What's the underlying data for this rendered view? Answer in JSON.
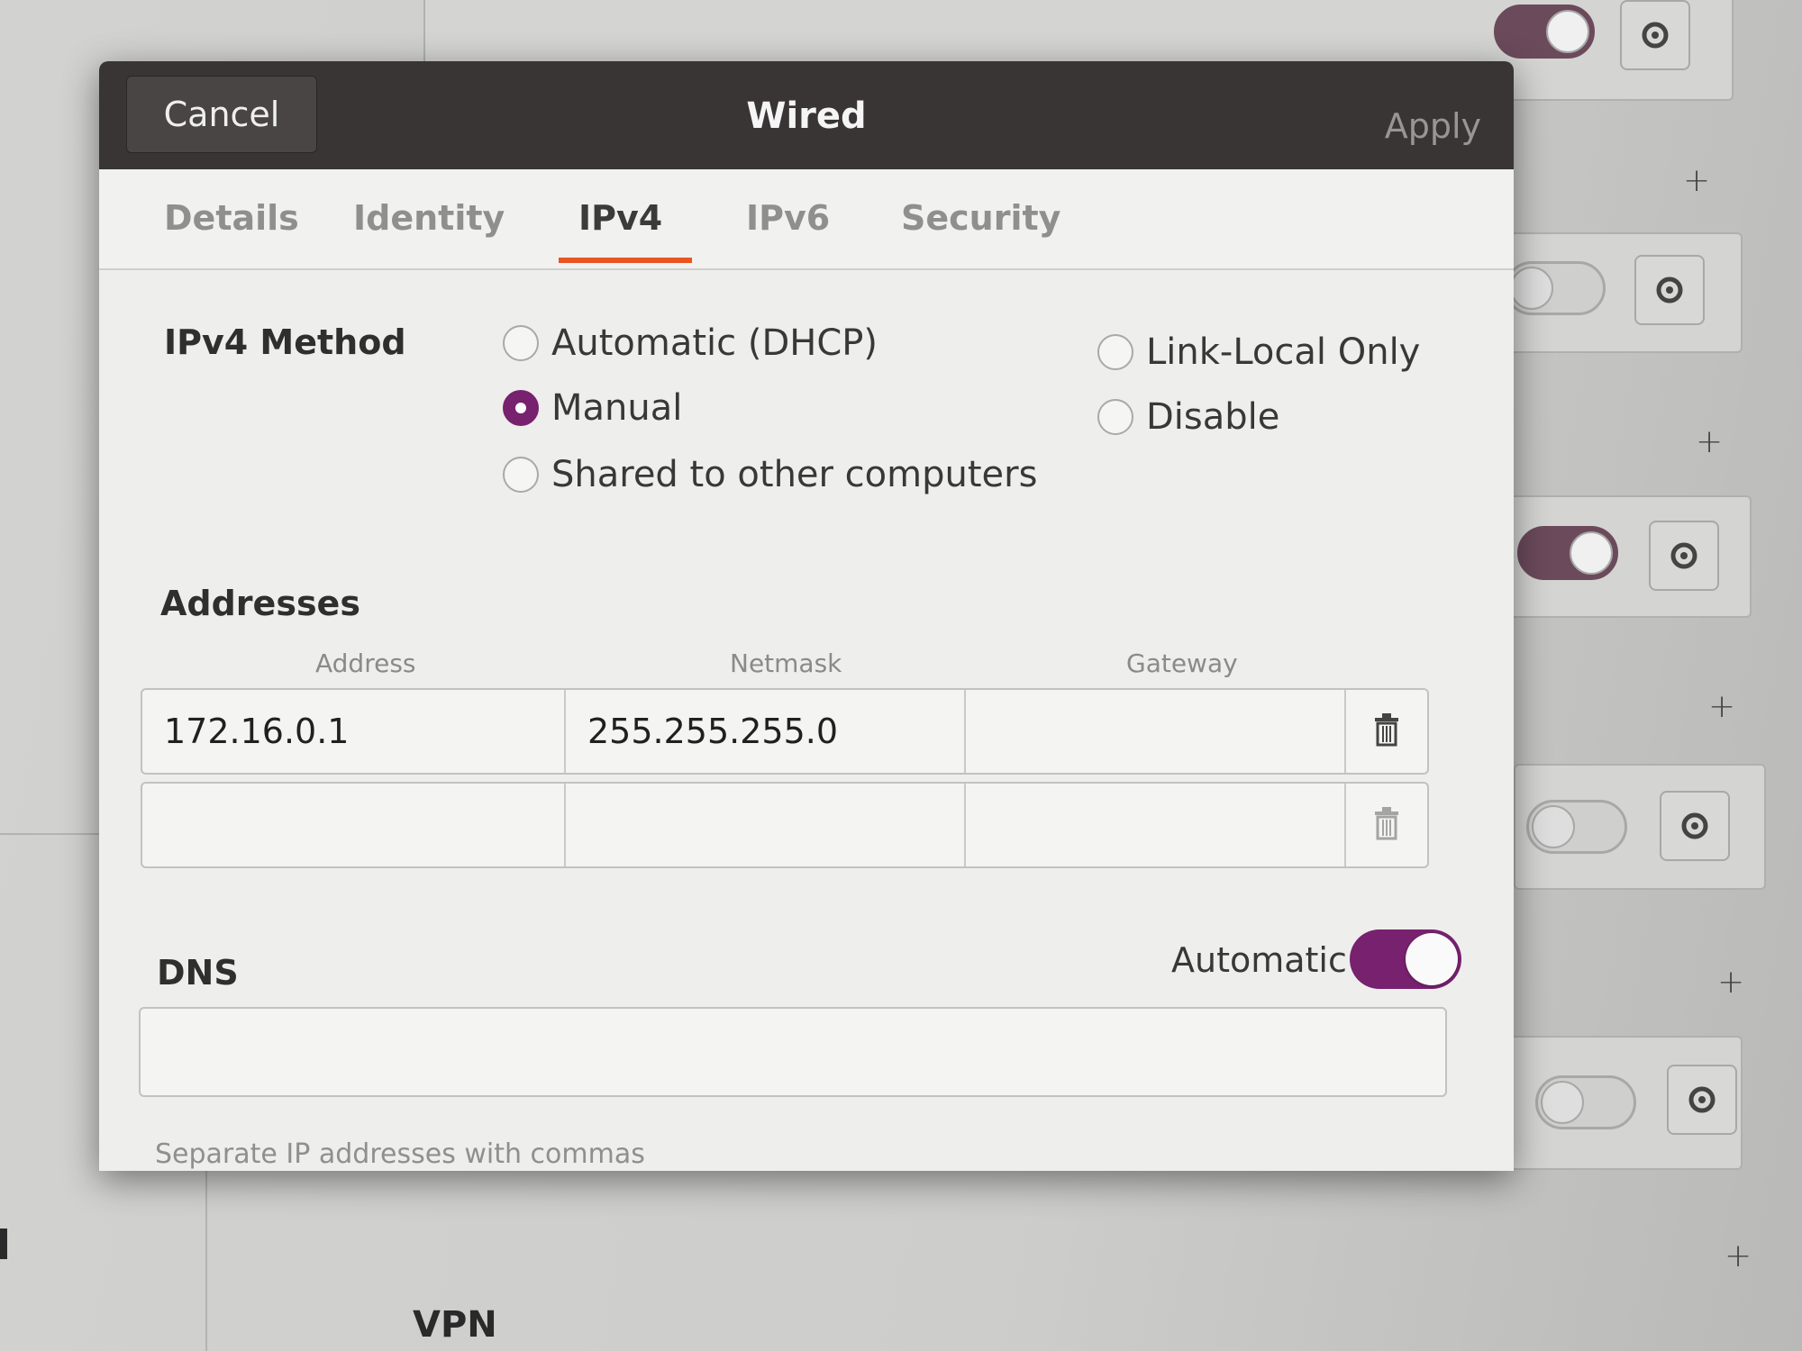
{
  "dialog": {
    "title": "Wired",
    "cancel_label": "Cancel",
    "apply_label": "Apply"
  },
  "tabs": [
    {
      "label": "Details",
      "active": false
    },
    {
      "label": "Identity",
      "active": false
    },
    {
      "label": "IPv4",
      "active": true
    },
    {
      "label": "IPv6",
      "active": false
    },
    {
      "label": "Security",
      "active": false
    }
  ],
  "ipv4_method": {
    "label": "IPv4 Method",
    "options": [
      {
        "label": "Automatic (DHCP)",
        "checked": false
      },
      {
        "label": "Manual",
        "checked": true
      },
      {
        "label": "Shared to other computers",
        "checked": false
      },
      {
        "label": "Link-Local Only",
        "checked": false
      },
      {
        "label": "Disable",
        "checked": false
      }
    ]
  },
  "addresses": {
    "label": "Addresses",
    "columns": [
      "Address",
      "Netmask",
      "Gateway"
    ],
    "rows": [
      {
        "address": "172.16.0.1",
        "netmask": "255.255.255.0",
        "gateway": ""
      },
      {
        "address": "",
        "netmask": "",
        "gateway": ""
      }
    ]
  },
  "dns": {
    "label": "DNS",
    "automatic_label": "Automatic",
    "automatic_on": true,
    "value": "",
    "hint": "Separate IP addresses with commas"
  },
  "background": {
    "section_label": "VPN",
    "toggles": [
      true,
      false,
      true,
      false,
      false
    ]
  },
  "colors": {
    "accent": "#77216f",
    "tab_underline": "#e95420",
    "headerbar": "#3a3535"
  }
}
